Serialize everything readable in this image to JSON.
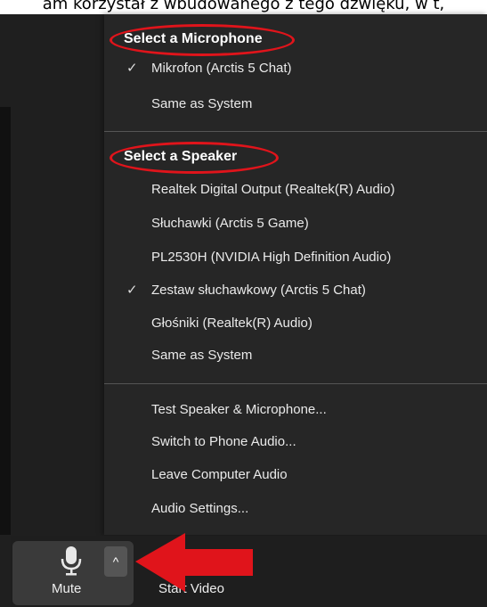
{
  "caption": "am korzystał z wbudowanego z tego dźwięku, w t,",
  "menu": {
    "microphone_title": "Select a Microphone",
    "microphones": [
      {
        "label": "Mikrofon (Arctis 5 Chat)",
        "checked": true
      },
      {
        "label": "Same as System",
        "checked": false
      }
    ],
    "speaker_title": "Select a Speaker",
    "speakers": [
      {
        "label": "Realtek Digital Output (Realtek(R) Audio)",
        "checked": false
      },
      {
        "label": "Słuchawki (Arctis 5 Game)",
        "checked": false
      },
      {
        "label": "PL2530H (NVIDIA High Definition Audio)",
        "checked": false
      },
      {
        "label": "Zestaw słuchawkowy (Arctis 5 Chat)",
        "checked": true
      },
      {
        "label": "Głośniki (Realtek(R) Audio)",
        "checked": false
      },
      {
        "label": "Same as System",
        "checked": false
      }
    ],
    "actions": [
      "Test Speaker & Microphone...",
      "Switch to Phone Audio...",
      "Leave Computer Audio",
      "Audio Settings..."
    ],
    "check_glyph": "✓"
  },
  "toolbar": {
    "mute_label": "Mute",
    "start_video_label": "Start Video",
    "caret_glyph": "^",
    "mic_icon": "microphone-icon"
  },
  "colors": {
    "highlight": "#e0141b",
    "menu_bg": "#262626",
    "toolbar_bg": "#1e1e1e"
  }
}
